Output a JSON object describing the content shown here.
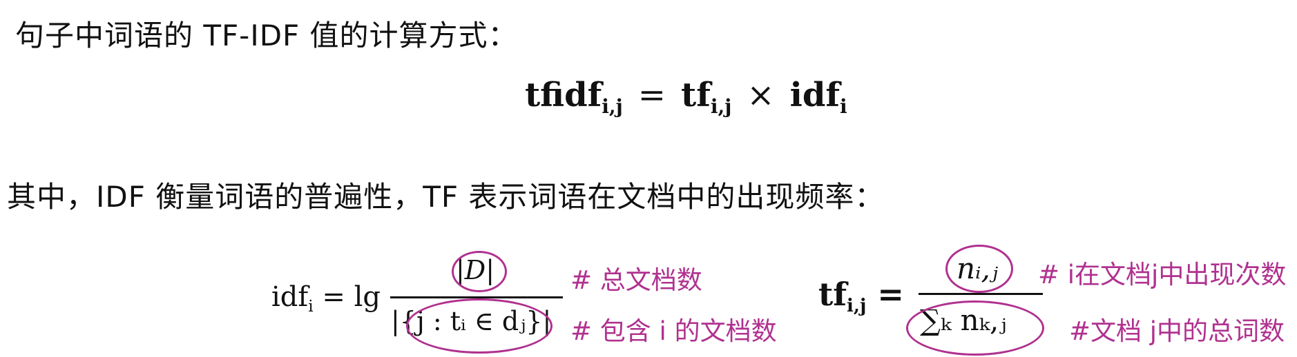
{
  "intro": "句子中词语的 TF-IDF 值的计算方式：",
  "main_formula": {
    "tfidf": "tfidf",
    "tfidf_sub": "i,j",
    "equals": "=",
    "tf": "tf",
    "tf_sub": "i,j",
    "times": "×",
    "idf": "idf",
    "idf_sub": "i"
  },
  "explanation": "其中，IDF 衡量词语的普遍性，TF 表示词语在文档中的出现频率：",
  "idf_formula": {
    "lhs": "idf",
    "lhs_sub": "i",
    "equals_lg": " = lg",
    "numerator": "|D|",
    "denominator": "|{j : tᵢ ∈ dⱼ}|",
    "note_numerator": "# 总文档数",
    "note_denominator": "# 包含 i 的文档数"
  },
  "tf_formula": {
    "lhs": "tf",
    "lhs_sub": "i,j",
    "equals": " =",
    "numerator": "nᵢ,ⱼ",
    "denominator": "∑ₖ nₖ,ⱼ",
    "note_numerator": "# i在文档j中出现次数",
    "note_denominator": "#文档 j中的总词数"
  },
  "colors": {
    "annotation": "#b0318f",
    "text": "#111111"
  }
}
